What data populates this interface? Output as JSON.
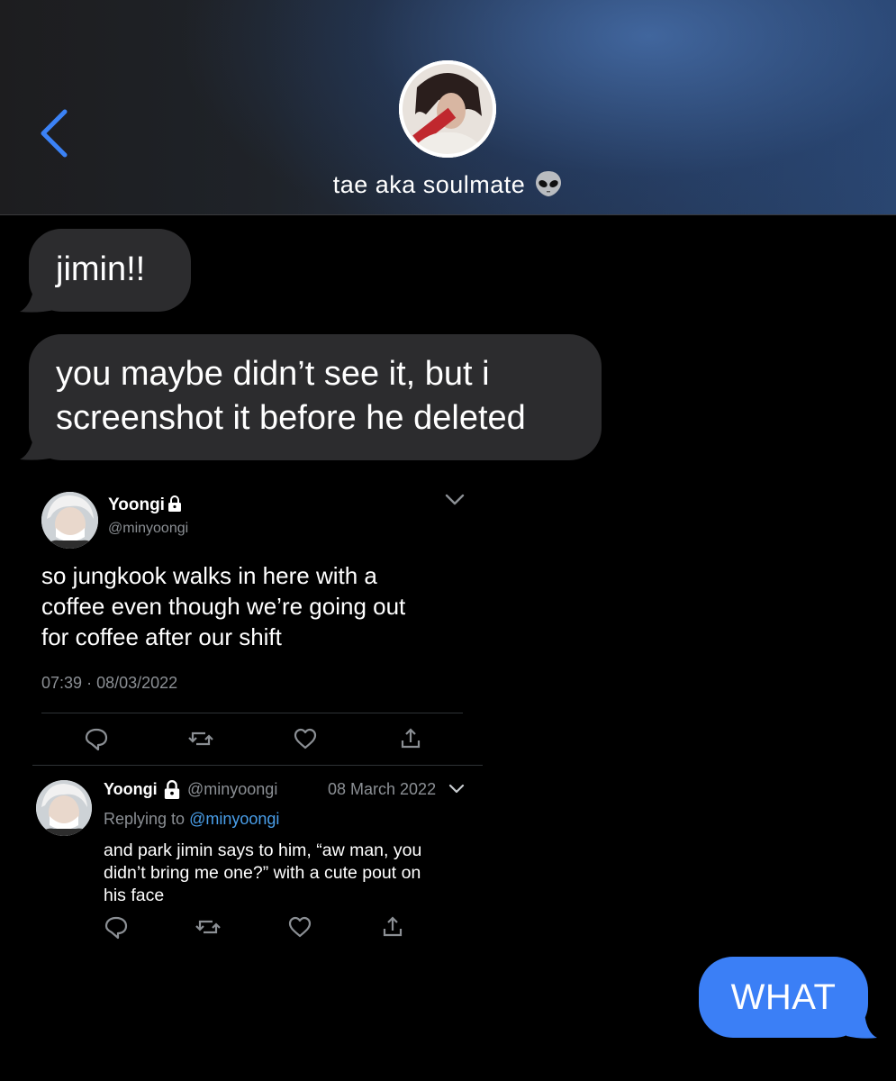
{
  "header": {
    "contact_name": "tae aka soulmate",
    "contact_emoji": "alien-face-icon",
    "back_icon": "chevron-left-icon",
    "accent_color": "#3b7ff6"
  },
  "messages": {
    "incoming_1": "jimin!!",
    "incoming_2_line1": "you maybe didn’t see it, but i",
    "incoming_2_line2": "screenshot it before he deleted",
    "outgoing_1": "WHAT"
  },
  "tweet": {
    "name": "Yoongi",
    "handle": "@minyoongi",
    "text_line1": "so jungkook walks in here with a",
    "text_line2": "coffee even though we’re going out",
    "text_line3": "for coffee after our shift",
    "time": "07:39",
    "date": "08/03/2022"
  },
  "reply": {
    "name": "Yoongi",
    "handle": "@minyoongi",
    "date": "08 March 2022",
    "replying_label": "Replying to",
    "replying_handle": "@minyoongi",
    "text_line1": "and park jimin says to him, “aw man, you",
    "text_line2": "didn’t bring me one?” with a cute pout on",
    "text_line3": "his face"
  },
  "icons": [
    "reply-icon",
    "retweet-icon",
    "like-icon",
    "share-icon",
    "lock-icon",
    "chevron-down-icon"
  ]
}
